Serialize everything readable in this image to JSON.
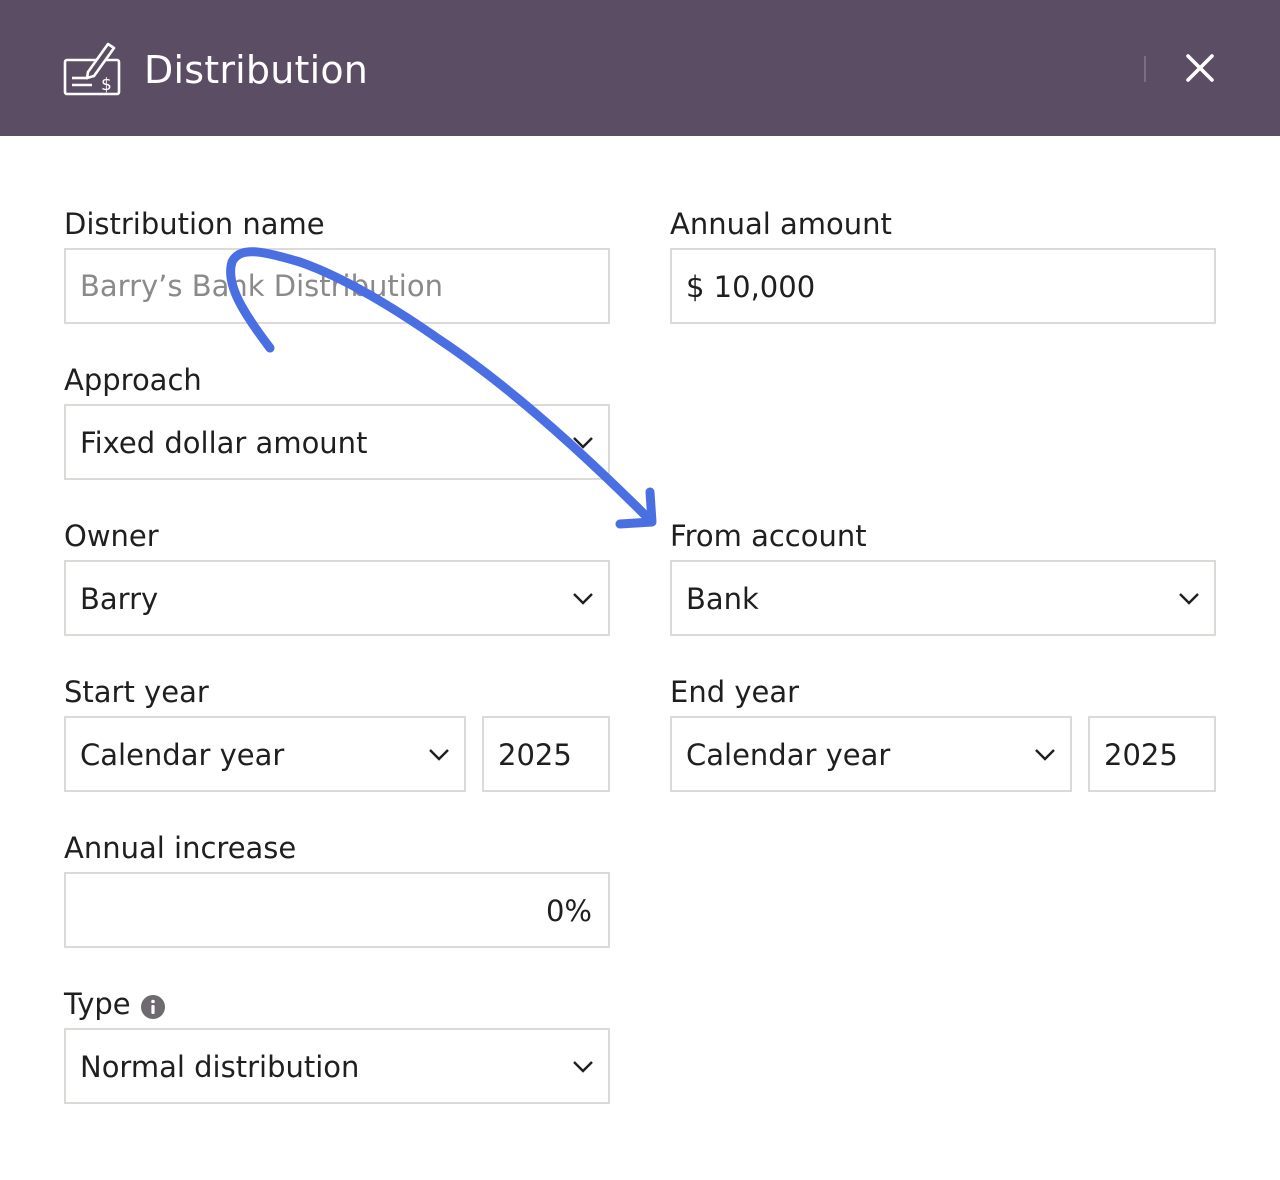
{
  "header": {
    "title": "Distribution",
    "icon": "check-payment-icon",
    "close_icon": "close-icon",
    "background_color": "#5b4d63"
  },
  "form": {
    "distribution_name": {
      "label": "Distribution name",
      "placeholder": "Barry’s Bank Distribution",
      "value": ""
    },
    "annual_amount": {
      "label": "Annual amount",
      "value": "$ 10,000"
    },
    "approach": {
      "label": "Approach",
      "value": "Fixed dollar amount"
    },
    "owner": {
      "label": "Owner",
      "value": "Barry"
    },
    "from_account": {
      "label": "From account",
      "value": "Bank"
    },
    "start_year": {
      "label": "Start year",
      "mode": "Calendar year",
      "year": "2025"
    },
    "end_year": {
      "label": "End year",
      "mode": "Calendar year",
      "year": "2025"
    },
    "annual_increase": {
      "label": "Annual increase",
      "value": "0%"
    },
    "type": {
      "label": "Type",
      "value": "Normal distribution",
      "info_icon": "info-icon"
    }
  },
  "annotation": {
    "color": "#4a6fe3"
  }
}
